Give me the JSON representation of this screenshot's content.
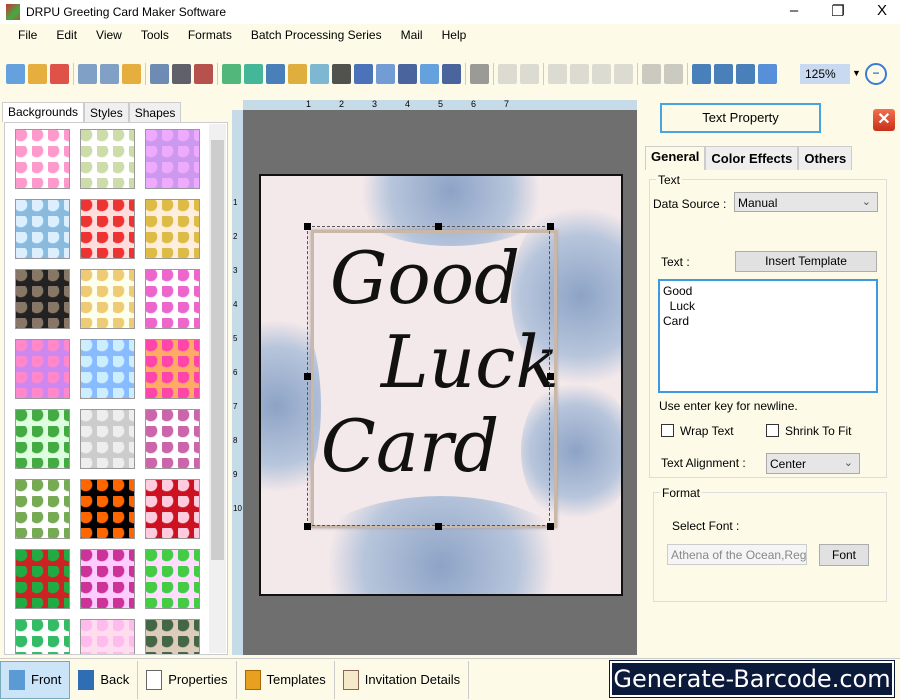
{
  "window": {
    "title": "DRPU Greeting Card Maker Software",
    "minimize": "–",
    "restore": "❐",
    "close": "X"
  },
  "menu": [
    "File",
    "Edit",
    "View",
    "Tools",
    "Formats",
    "Batch Processing Series",
    "Mail",
    "Help"
  ],
  "toolbar": {
    "zoom_value": "125%",
    "icons": [
      "new",
      "open",
      "close",
      "save",
      "save-as",
      "export",
      "properties",
      "print",
      "print-preview",
      "background",
      "image",
      "pen",
      "shape",
      "watermark",
      "barcode",
      "text-art",
      "text",
      "signature",
      "email",
      "line",
      "database",
      "undo",
      "redo",
      "cut",
      "copy",
      "paste",
      "delete",
      "bring-front",
      "send-back",
      "grid",
      "actual-size",
      "fit",
      "zoom-in",
      "zoom-out"
    ]
  },
  "left_panel": {
    "tabs": [
      "Backgrounds",
      "Styles",
      "Shapes"
    ],
    "active_tab": "Backgrounds"
  },
  "ruler": {
    "top": [
      "1",
      "2",
      "3",
      "4",
      "5",
      "6",
      "7"
    ],
    "left": [
      "1",
      "2",
      "3",
      "4",
      "5",
      "6",
      "7",
      "8",
      "9",
      "10"
    ]
  },
  "card": {
    "lines": [
      "Good",
      "Luck",
      "Card"
    ]
  },
  "right_panel": {
    "title": "Text Property",
    "tabs": [
      "General",
      "Color Effects",
      "Others"
    ],
    "text_group": "Text",
    "data_source_label": "Data Source :",
    "data_source_value": "Manual",
    "text_label": "Text :",
    "insert_template": "Insert Template",
    "text_value": "Good\n  Luck\nCard",
    "hint": "Use enter key for newline.",
    "wrap_text": "Wrap Text",
    "wrap_checked": false,
    "shrink_to_fit": "Shrink To Fit",
    "shrink_checked": false,
    "alignment_label": "Text Alignment :",
    "alignment_value": "Center",
    "format_group": "Format",
    "select_font_label": "Select Font :",
    "font_value": "Athena of the Ocean,Regular",
    "font_button": "Font"
  },
  "bottom": {
    "tabs": [
      "Front",
      "Back",
      "Properties",
      "Templates",
      "Invitation Details"
    ],
    "active": "Front",
    "brand": "Generate-Barcode.com"
  }
}
